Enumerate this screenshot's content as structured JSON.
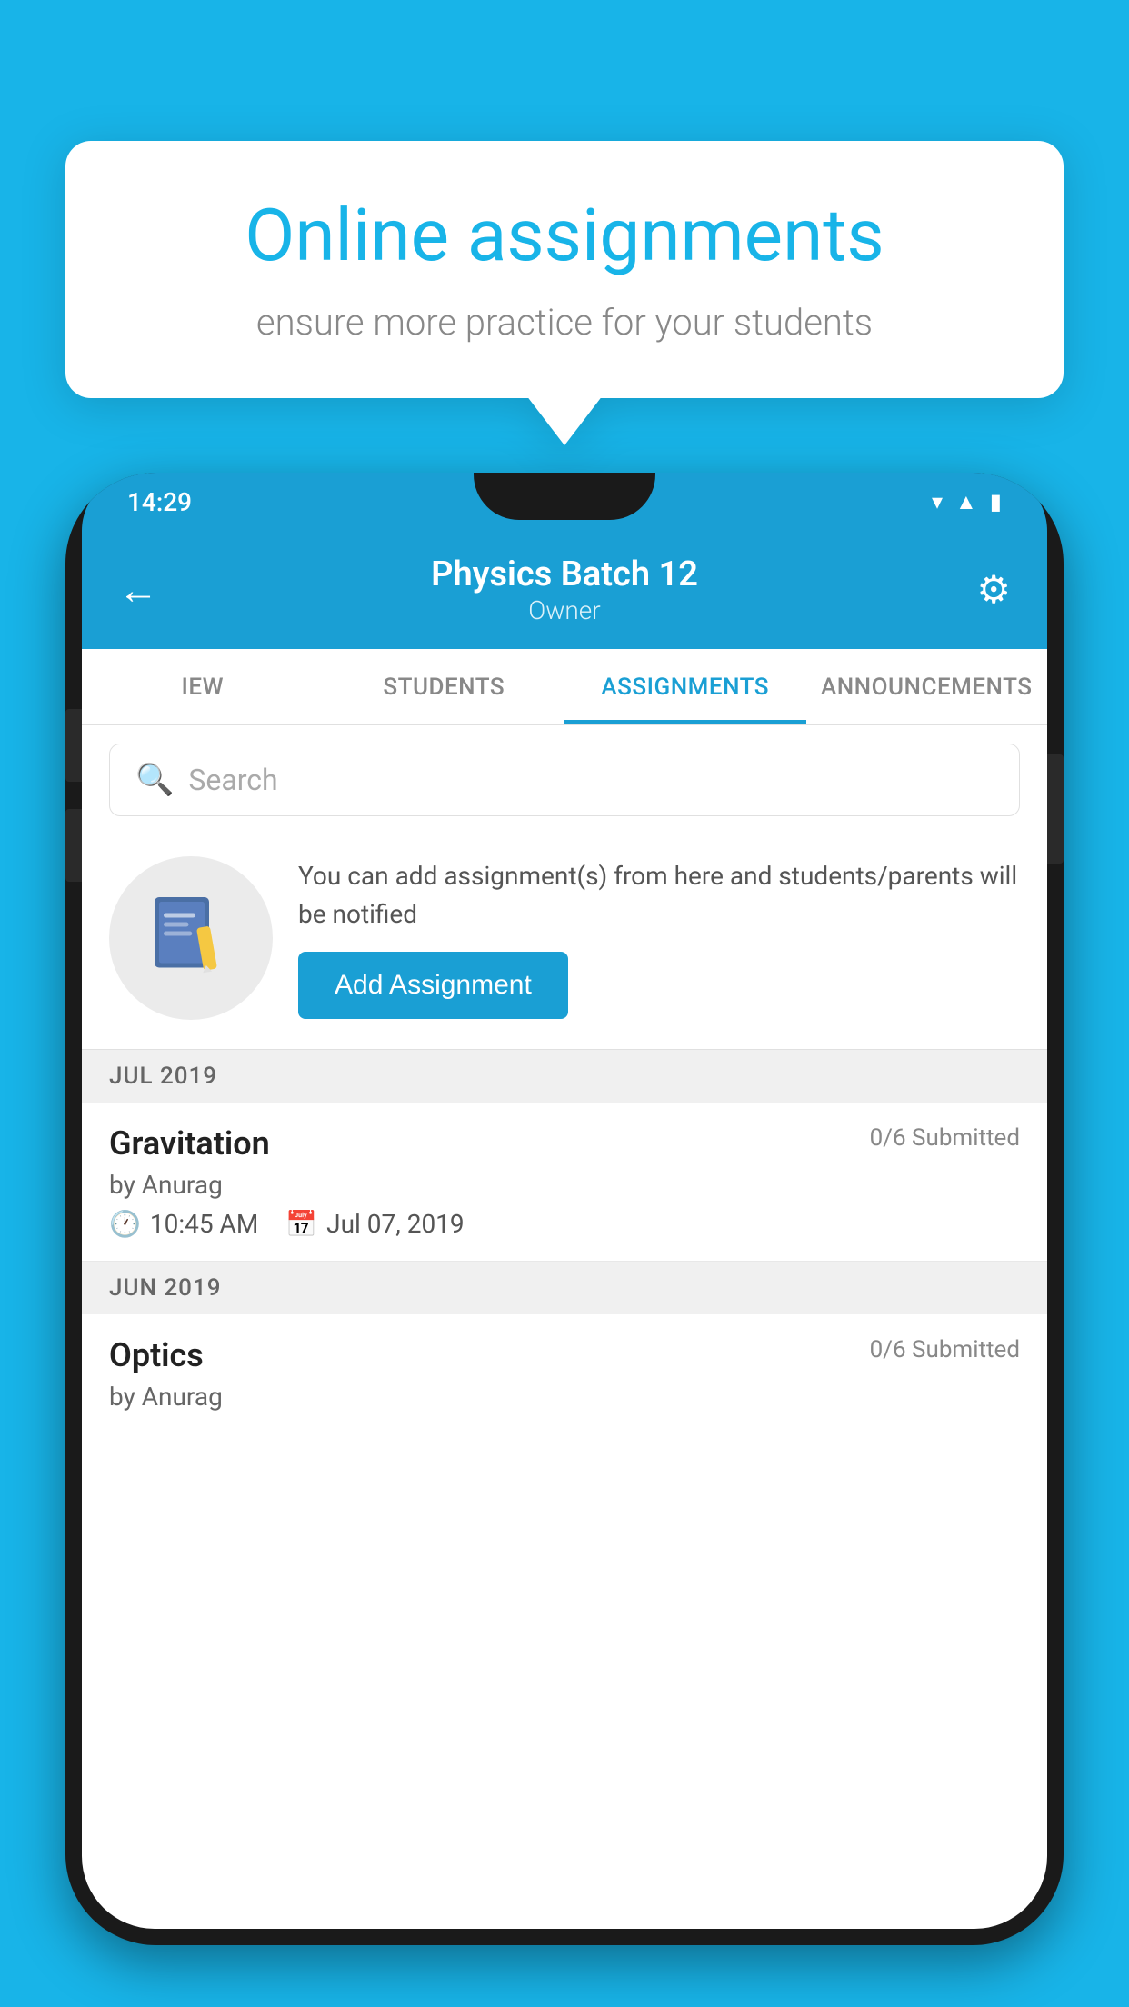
{
  "background": {
    "color": "#18b4e8"
  },
  "promo": {
    "title": "Online assignments",
    "subtitle": "ensure more practice for your students"
  },
  "statusBar": {
    "time": "14:29",
    "icons": [
      "wifi",
      "signal",
      "battery"
    ]
  },
  "appBar": {
    "title": "Physics Batch 12",
    "subtitle": "Owner",
    "backLabel": "←",
    "settingsLabel": "⚙"
  },
  "tabs": [
    {
      "id": "view",
      "label": "IEW",
      "active": false
    },
    {
      "id": "students",
      "label": "STUDENTS",
      "active": false
    },
    {
      "id": "assignments",
      "label": "ASSIGNMENTS",
      "active": true
    },
    {
      "id": "announcements",
      "label": "ANNOUNCEMENTS",
      "active": false
    }
  ],
  "search": {
    "placeholder": "Search"
  },
  "assignmentPromo": {
    "description": "You can add assignment(s) from here and students/parents will be notified",
    "buttonLabel": "Add Assignment"
  },
  "sections": [
    {
      "month": "JUL 2019",
      "assignments": [
        {
          "name": "Gravitation",
          "submitted": "0/6 Submitted",
          "author": "by Anurag",
          "time": "10:45 AM",
          "date": "Jul 07, 2019"
        }
      ]
    },
    {
      "month": "JUN 2019",
      "assignments": [
        {
          "name": "Optics",
          "submitted": "0/6 Submitted",
          "author": "by Anurag",
          "time": "",
          "date": ""
        }
      ]
    }
  ]
}
